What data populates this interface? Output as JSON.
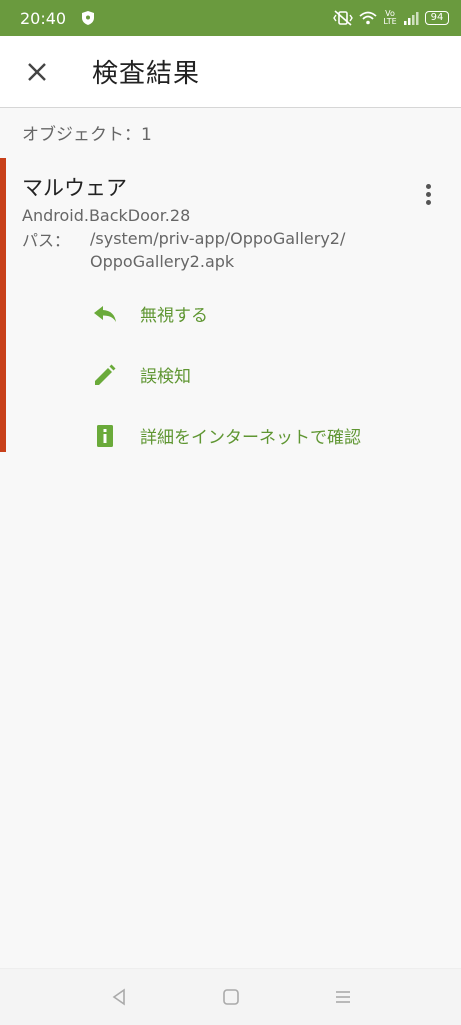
{
  "status_bar": {
    "time": "20:40",
    "battery": "94",
    "volte": "Vo LTE",
    "icons": [
      "shield-icon",
      "vibrate-icon",
      "wifi-icon",
      "signal-icon",
      "battery-icon"
    ]
  },
  "app_bar": {
    "title": "検査結果",
    "close_icon": "close-icon"
  },
  "objects_label": "オブジェクト：1",
  "result": {
    "type": "マルウェア",
    "name": "Android.BackDoor.28",
    "path_label": "パス：",
    "path_line1": "/system/priv-app/OppoGallery2/",
    "path_line2": "OppoGallery2.apk",
    "accent_color": "#c8401a"
  },
  "actions": [
    {
      "label": "無視する",
      "icon": "reply-icon"
    },
    {
      "label": "誤検知",
      "icon": "pencil-icon"
    },
    {
      "label": "詳細をインターネットで確認",
      "icon": "info-icon"
    }
  ],
  "colors": {
    "status_bar": "#6a9a3e",
    "action": "#5f9632"
  }
}
